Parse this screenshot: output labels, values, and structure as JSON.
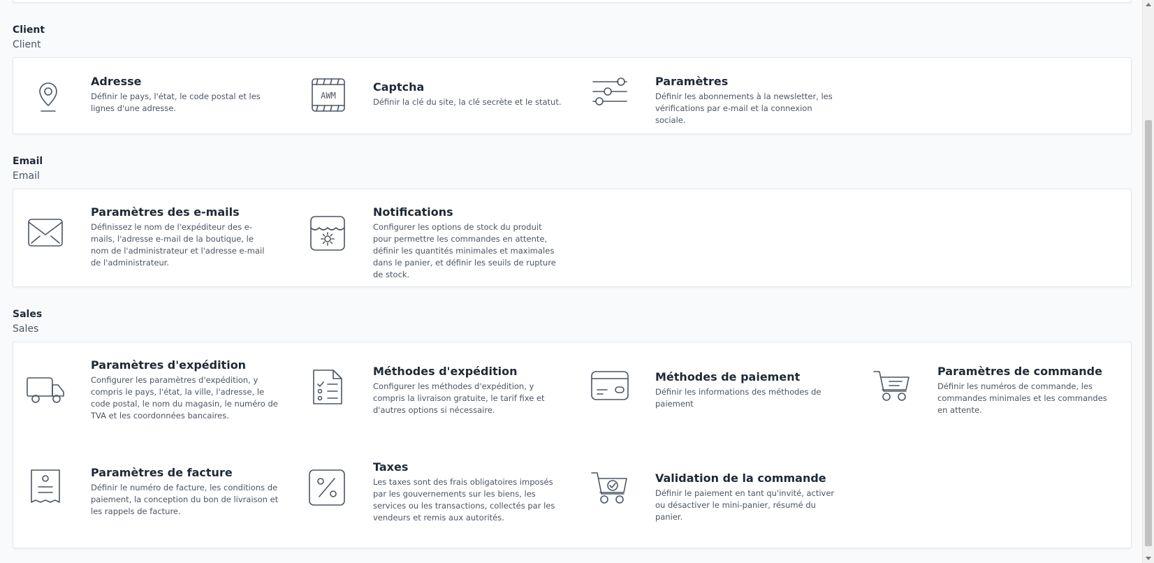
{
  "sections": [
    {
      "title": "Client",
      "subtitle": "Client",
      "items": [
        {
          "title": "Adresse",
          "description": "Définir le pays, l'état, le code postal et les lignes d'une adresse.",
          "icon": "map-pin-icon"
        },
        {
          "title": "Captcha",
          "description": "Définir la clé du site, la clé secrète et le statut.",
          "icon": "captcha-icon"
        },
        {
          "title": "Paramètres",
          "description": "Définir les abonnements à la newsletter, les vérifications par e-mail et la connexion sociale.",
          "icon": "sliders-icon"
        }
      ]
    },
    {
      "title": "Email",
      "subtitle": "Email",
      "items": [
        {
          "title": "Paramètres des e-mails",
          "description": "Définissez le nom de l'expéditeur des e-mails, l'adresse e-mail de la boutique, le nom de l'administrateur et l'adresse e-mail de l'administrateur.",
          "icon": "envelope-icon"
        },
        {
          "title": "Notifications",
          "description": "Configurer les options de stock du produit pour permettre les commandes en attente, définir les quantités minimales et maximales dans le panier, et définir les seuils de rupture de stock.",
          "icon": "notification-settings-icon"
        }
      ]
    },
    {
      "title": "Sales",
      "subtitle": "Sales",
      "items": [
        {
          "title": "Paramètres d'expédition",
          "description": "Configurer les paramètres d'expédition, y compris le pays, l'état, la ville, l'adresse, le code postal, le nom du magasin, le numéro de TVA et les coordonnées bancaires.",
          "icon": "truck-icon"
        },
        {
          "title": "Méthodes d'expédition",
          "description": "Configurer les méthodes d'expédition, y compris la livraison gratuite, le tarif fixe et d'autres options si nécessaire.",
          "icon": "checklist-icon"
        },
        {
          "title": "Méthodes de paiement",
          "description": "Définir les informations des méthodes de paiement",
          "icon": "credit-card-icon"
        },
        {
          "title": "Paramètres de commande",
          "description": "Définir les numéros de commande, les commandes minimales et les commandes en attente.",
          "icon": "cart-icon"
        },
        {
          "title": "Paramètres de facture",
          "description": "Définir le numéro de facture, les conditions de paiement, la conception du bon de livraison et les rappels de facture.",
          "icon": "receipt-icon"
        },
        {
          "title": "Taxes",
          "description": "Les taxes sont des frais obligatoires imposés par les gouvernements sur les biens, les services ou les transactions, collectés par les vendeurs et remis aux autorités.",
          "icon": "percent-icon"
        },
        {
          "title": "Validation de la commande",
          "description": "Définir le paiement en tant qu'invité, activer ou désactiver le mini-panier, résumé du panier.",
          "icon": "cart-check-icon"
        }
      ]
    }
  ]
}
